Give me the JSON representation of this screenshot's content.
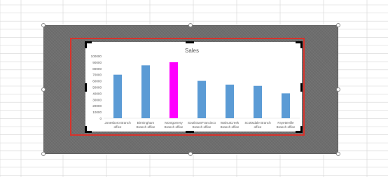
{
  "colors": {
    "grid_line": "#d6d6d6",
    "frame": "#6e6e6e",
    "selection_border": "#d8322b",
    "bar_default": "#5b9bd5",
    "bar_highlight": "#ff00ff",
    "axis_text": "#595959"
  },
  "chart_data": {
    "type": "bar",
    "title": "Sales",
    "xlabel": "",
    "ylabel": "",
    "ylim": [
      0,
      100000
    ],
    "y_ticks": [
      "0",
      "10000",
      "20000",
      "30000",
      "40000",
      "50000",
      "60000",
      "70000",
      "80000",
      "90000",
      "100000"
    ],
    "categories": [
      [
        "Jonesboro Branch",
        "office"
      ],
      [
        "Birmingham",
        "Branch office"
      ],
      [
        "Montgomery",
        "Branch office"
      ],
      [
        "SouthSanFrancisco",
        "Branch office"
      ],
      [
        "WalnutCreek",
        "Branch office"
      ],
      [
        "Scottsdale Branch",
        "office"
      ],
      [
        "Fayetteville",
        "Branch office"
      ]
    ],
    "values": [
      70000,
      85000,
      90000,
      60000,
      54000,
      52000,
      40000
    ],
    "highlighted_index": 2,
    "grid": false,
    "legend": "none"
  },
  "icons": {
    "resize_handle": "circle-handle-icon",
    "crop_handle": "crop-corner-icon"
  }
}
